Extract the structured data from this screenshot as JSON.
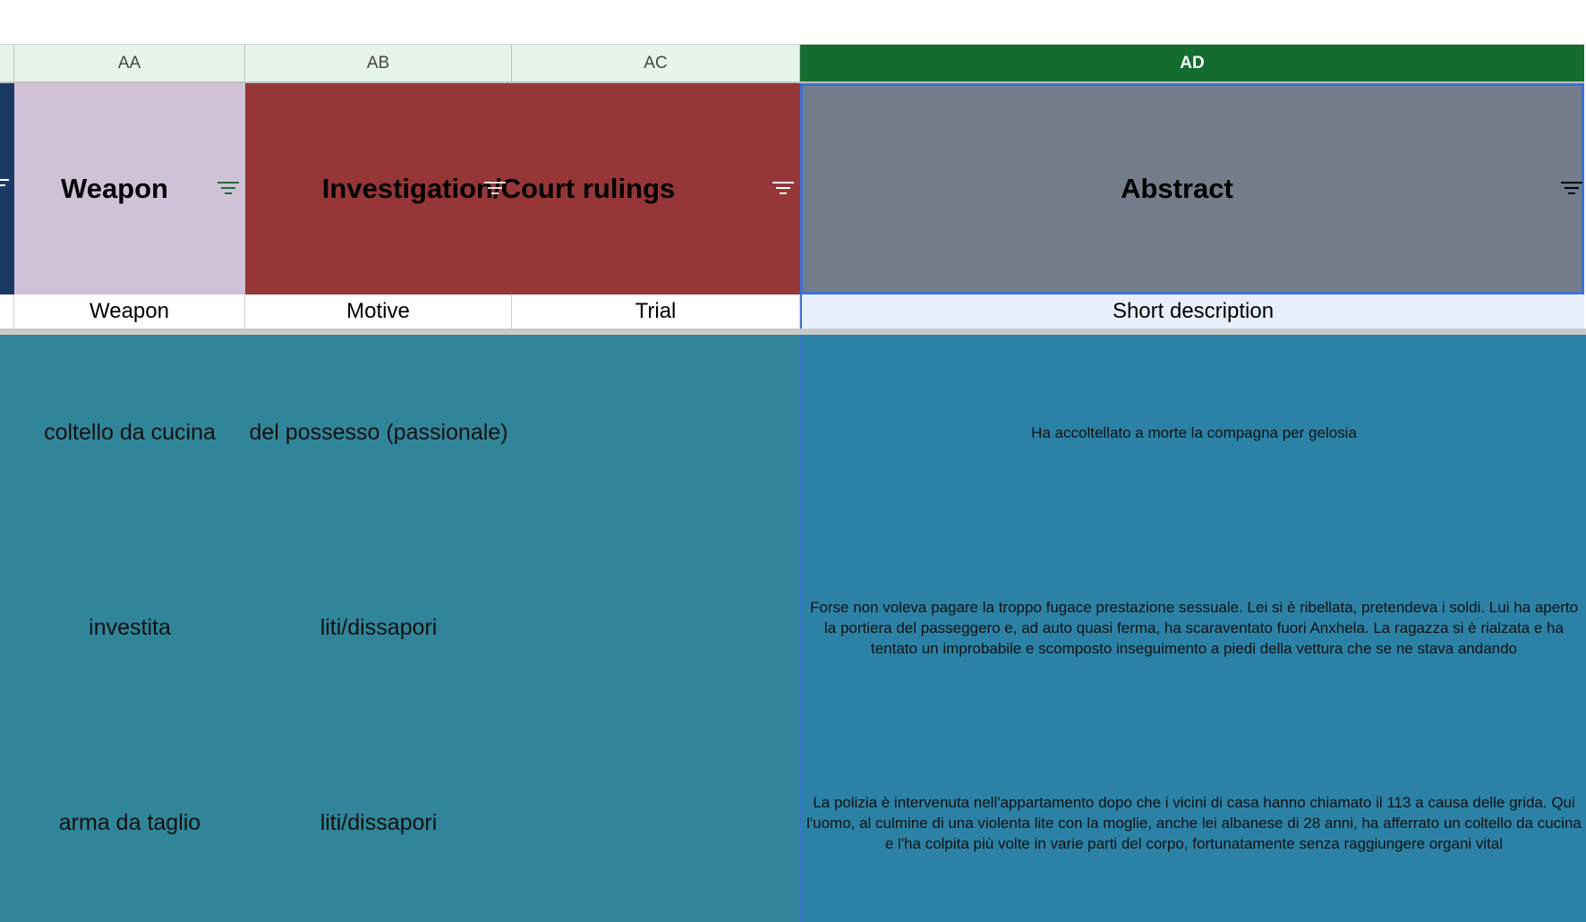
{
  "column_headers": [
    "AA",
    "AB",
    "AC",
    "AD"
  ],
  "header_band": {
    "weapon": "Weapon",
    "investigation": "Investigation/Court rulings",
    "abstract": "Abstract"
  },
  "subheaders": {
    "weapon": "Weapon",
    "motive": "Motive",
    "trial": "Trial",
    "short_description": "Short description"
  },
  "rows": [
    {
      "weapon": "coltello da cucina",
      "motive": "del possesso (passionale)",
      "trial": "",
      "description": "Ha accoltellato a morte la compagna per gelosia"
    },
    {
      "weapon": "investita",
      "motive": "liti/dissapori",
      "trial": "",
      "description": "Forse non voleva pagare la troppo fugace prestazione sessuale. Lei si è ribellata, pretendeva i soldi. Lui ha aperto la portiera del passeggero e, ad auto quasi ferma, ha scaraventato fuori Anxhela. La ragazza si è rialzata e ha tentato un improbabile e scomposto inseguimento a piedi della vettura che se ne stava andando"
    },
    {
      "weapon": "arma da taglio",
      "motive": "liti/dissapori",
      "trial": "",
      "description": "La polizia è intervenuta nell'appartamento dopo che i vicini di casa hanno chiamato il 113 a causa delle grida. Qui l'uomo, al culmine di una violenta lite con la moglie, anche lei albanese di 28 anni, ha afferrato un coltello da cucina e l'ha colpita più volte in varie parti del corpo, fortunatamente senza raggiungere organi vital"
    }
  ],
  "colors": {
    "selected_column_header": "#146c2e",
    "weapon_band": "#d0c0d8",
    "investigation_band": "#963636",
    "abstract_band": "#737c8b",
    "data_teal": "#308599",
    "data_blue": "#2b82a6",
    "selection_border": "#3b72d9"
  }
}
